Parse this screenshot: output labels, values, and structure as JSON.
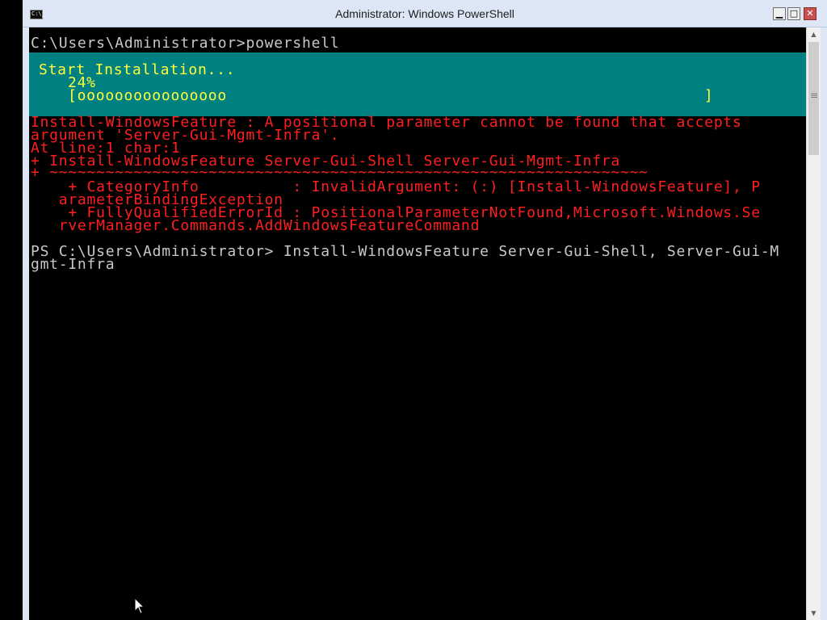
{
  "window": {
    "title": "Administrator: Windows PowerShell",
    "icon_label": "C:\\_",
    "minimize_label": "▁",
    "maximize_label": "□",
    "close_label": "✕"
  },
  "console": {
    "lines": [
      "C:\\Users\\Administrator>powershell",
      "Install-WindowsFeature : A positional parameter cannot be found that accepts",
      "argument 'Server-Gui-Mgmt-Infra'.",
      "At line:1 char:1",
      "+ Install-WindowsFeature Server-Gui-Shell Server-Gui-Mgmt-Infra",
      "+ ~~~~~~~~~~~~~~~~~~~~~~~~~~~~~~~~~~~~~~~~~~~~~~~~~~~~~~~~~~~~~~~~",
      "    + CategoryInfo          : InvalidArgument: (:) [Install-WindowsFeature], P",
      "   arameterBindingException",
      "    + FullyQualifiedErrorId : PositionalParameterNotFound,Microsoft.Windows.Se",
      "   rverManager.Commands.AddWindowsFeatureCommand",
      "PS C:\\Users\\Administrator> Install-WindowsFeature Server-Gui-Shell, Server-Gui-M",
      "gmt-Infra"
    ]
  },
  "progress": {
    "heading": "Start Installation...",
    "percent_text": "24%",
    "percent": 24,
    "bar_text": "[oooooooooooooooo                                                   ]"
  },
  "scrollbar": {
    "up_arrow": "▲",
    "down_arrow": "▼",
    "grip": "≡"
  },
  "colors": {
    "console_bg": "#000000",
    "progress_bg": "#008080",
    "progress_text": "#ffff3c",
    "error_text": "#ff1e1e",
    "normal_text": "#c8c8c8"
  }
}
